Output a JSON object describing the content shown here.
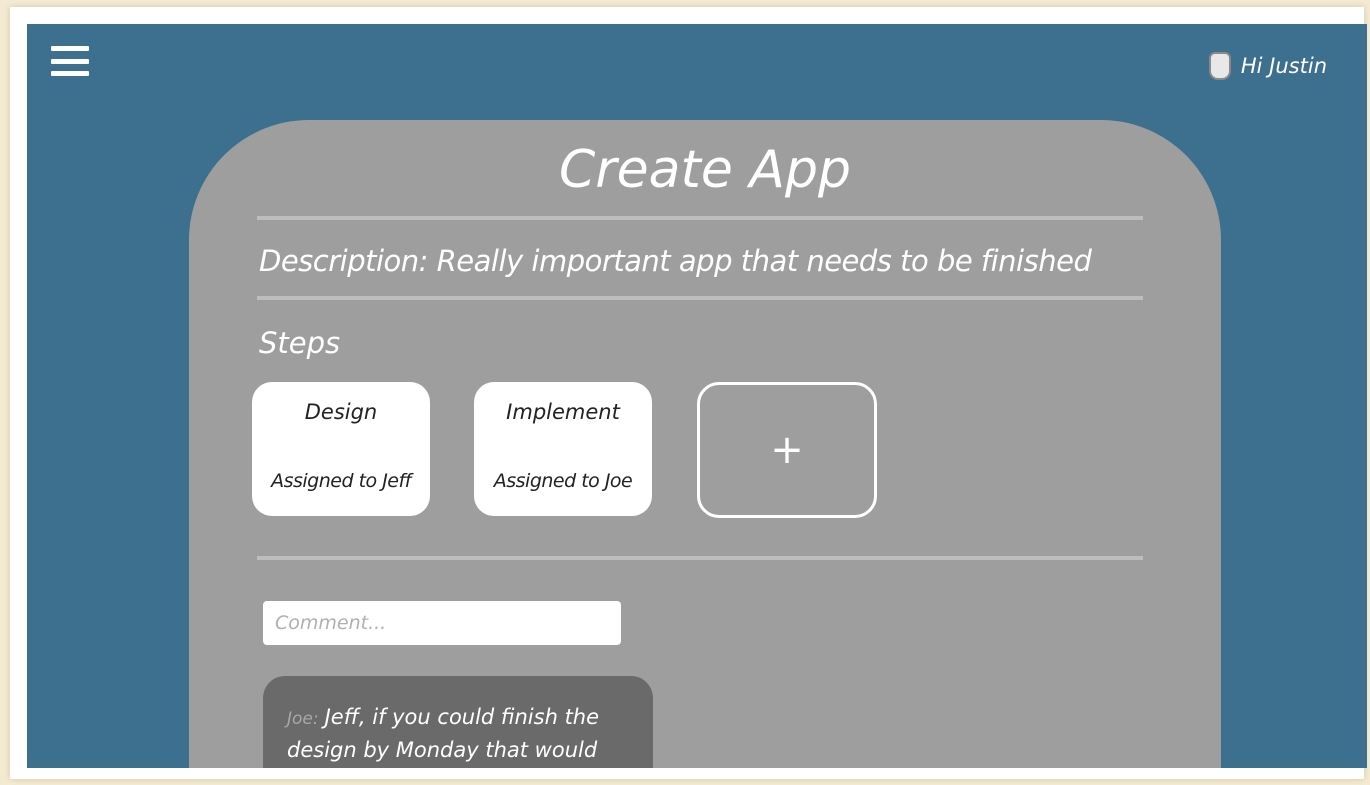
{
  "header": {
    "menu_icon": "hamburger-menu-icon",
    "user_icon": "user-avatar-icon",
    "greeting": "Hi Justin"
  },
  "card": {
    "title": "Create App",
    "description": "Description: Really important app that needs to be finished",
    "steps_label": "Steps",
    "steps": [
      {
        "name": "Design",
        "assigned": "Assigned to Jeff"
      },
      {
        "name": "Implement",
        "assigned": "Assigned to Joe"
      }
    ],
    "add_step_label": "+",
    "comment_placeholder": "Comment...",
    "comments": [
      {
        "author": "Joe:",
        "text": "Jeff, if you could finish the design by Monday that would be"
      }
    ]
  },
  "colors": {
    "background": "#3d6f8e",
    "card": "#9e9e9e",
    "comment_bubble": "#6a6a6a"
  }
}
